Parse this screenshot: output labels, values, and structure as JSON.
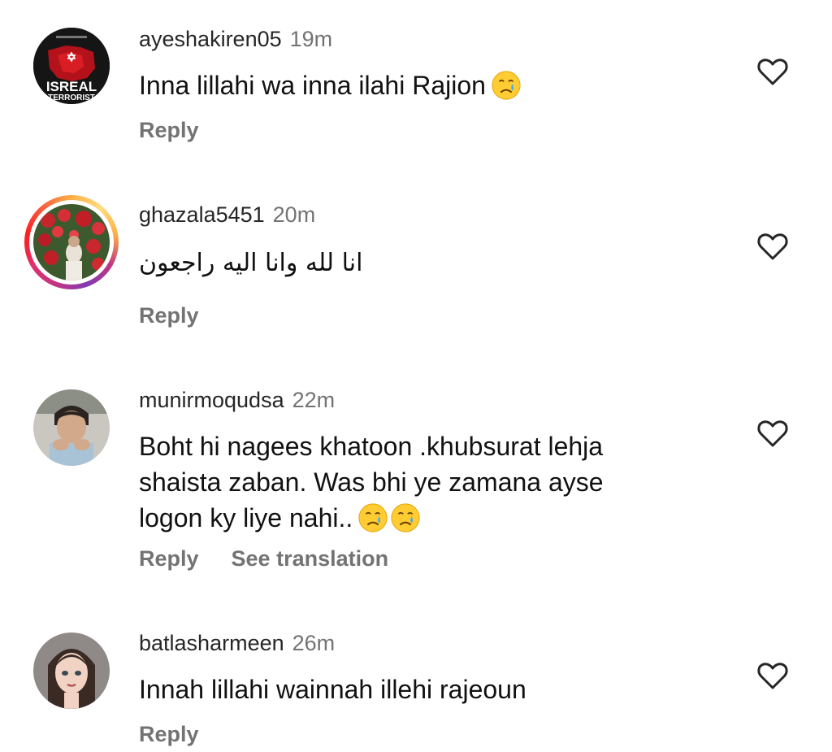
{
  "comments": [
    {
      "username": "ayeshakiren05",
      "time": "19m",
      "text": "Inna lillahi wa inna ilahi Rajion",
      "emoji_count": 1,
      "emoji": "crying-face",
      "avatar": {
        "label_top": "ISREAL",
        "label_bottom": "TERRORIST"
      },
      "actions": [
        "Reply"
      ]
    },
    {
      "username": "ghazala5451",
      "time": "20m",
      "text": "انا لله وانا اليه راجعون",
      "actions": [
        "Reply"
      ]
    },
    {
      "username": "munirmoqudsa",
      "time": "22m",
      "text_lines": [
        "Boht hi nagees khatoon .khubsurat lehja",
        "shaista zaban. Was bhi ye zamana ayse",
        "logon ky liye nahi.."
      ],
      "emoji_count": 2,
      "emoji": "crying-face",
      "actions": [
        "Reply",
        "See translation"
      ]
    },
    {
      "username": "batlasharmeen",
      "time": "26m",
      "text": "Innah lillahi wainnah illehi rajeoun",
      "actions": [
        "Reply"
      ]
    }
  ],
  "icons": {
    "like": "heart-outline-icon",
    "emoji": "crying-face-emoji"
  },
  "colors": {
    "username": "#262626",
    "secondary": "#737373",
    "story_ring": [
      "#833ab4",
      "#c13584",
      "#e1306c",
      "#fd1d1d",
      "#f56040",
      "#fcaf45"
    ]
  }
}
